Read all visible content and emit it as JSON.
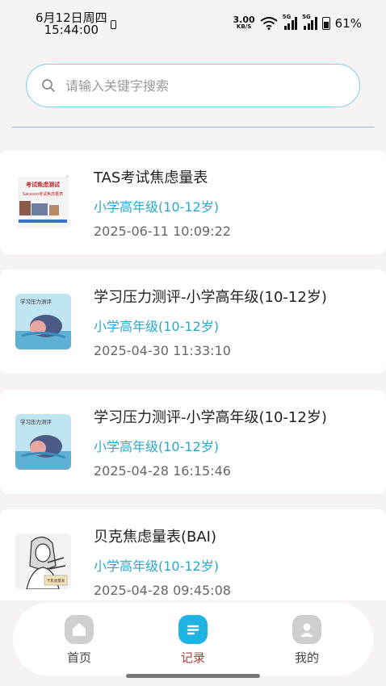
{
  "status": {
    "date": "6月12日周四",
    "time": "15:44:00",
    "speed_value": "3.00",
    "speed_unit": "KB/S",
    "signal1": "5G",
    "signal2": "5G",
    "battery": "61%"
  },
  "search": {
    "placeholder": "请输入关键字搜索",
    "value": ""
  },
  "records": [
    {
      "title": "TAS考试焦虑量表",
      "grade": "小学高年级(10-12岁)",
      "date": "2025-06-11 10:09:22",
      "thumb_text": "考试焦虑测试",
      "thumb_sub": "Sarason考试焦虑量表"
    },
    {
      "title": "学习压力测评-小学高年级(10-12岁)",
      "grade": "小学高年级(10-12岁)",
      "date": "2025-04-30 11:33:10",
      "thumb_text": "学习压力测评"
    },
    {
      "title": "学习压力测评-小学高年级(10-12岁)",
      "grade": "小学高年级(10-12岁)",
      "date": "2025-04-28 16:15:46",
      "thumb_text": "学习压力测评"
    },
    {
      "title": "贝克焦虑量表(BAI)",
      "grade": "小学高年级(10-12岁)",
      "date": "2025-04-28 09:45:08",
      "thumb_text": "卡焦虑量表"
    }
  ],
  "nav": {
    "home": "首页",
    "records": "记录",
    "mine": "我的"
  },
  "colors": {
    "accent": "#27a9cf",
    "active_icon": "#1fb3e3",
    "inactive_icon": "#c9c9c9"
  }
}
